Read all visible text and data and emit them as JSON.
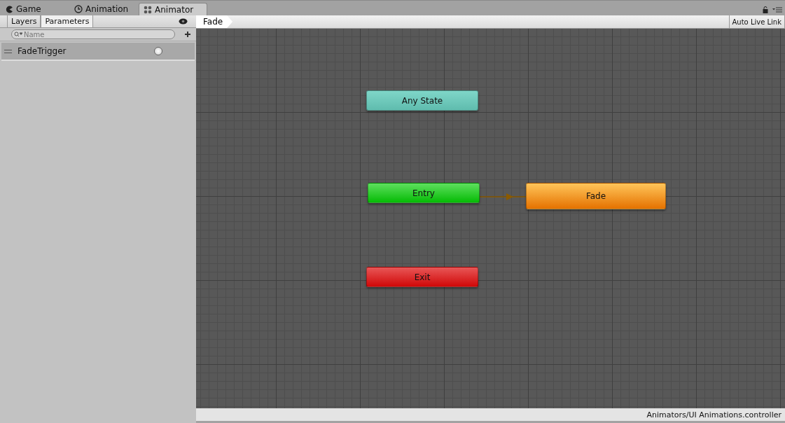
{
  "tabs": [
    {
      "label": "Game",
      "selected": false
    },
    {
      "label": "Animation",
      "selected": false
    },
    {
      "label": "Animator",
      "selected": true
    }
  ],
  "left_panel": {
    "tabs": [
      {
        "label": "Layers",
        "selected": false
      },
      {
        "label": "Parameters",
        "selected": true
      }
    ],
    "search": {
      "placeholder": "Name"
    },
    "parameters": [
      {
        "name": "FadeTrigger",
        "kind": "trigger"
      }
    ]
  },
  "breadcrumb": "Fade",
  "auto_live_link": "Auto Live Link",
  "nodes": [
    {
      "label": "Any State",
      "kind": "any"
    },
    {
      "label": "Entry",
      "kind": "entry"
    },
    {
      "label": "Fade",
      "kind": "state"
    },
    {
      "label": "Exit",
      "kind": "exit"
    }
  ],
  "status_bar": "Animators/UI Animations.controller"
}
